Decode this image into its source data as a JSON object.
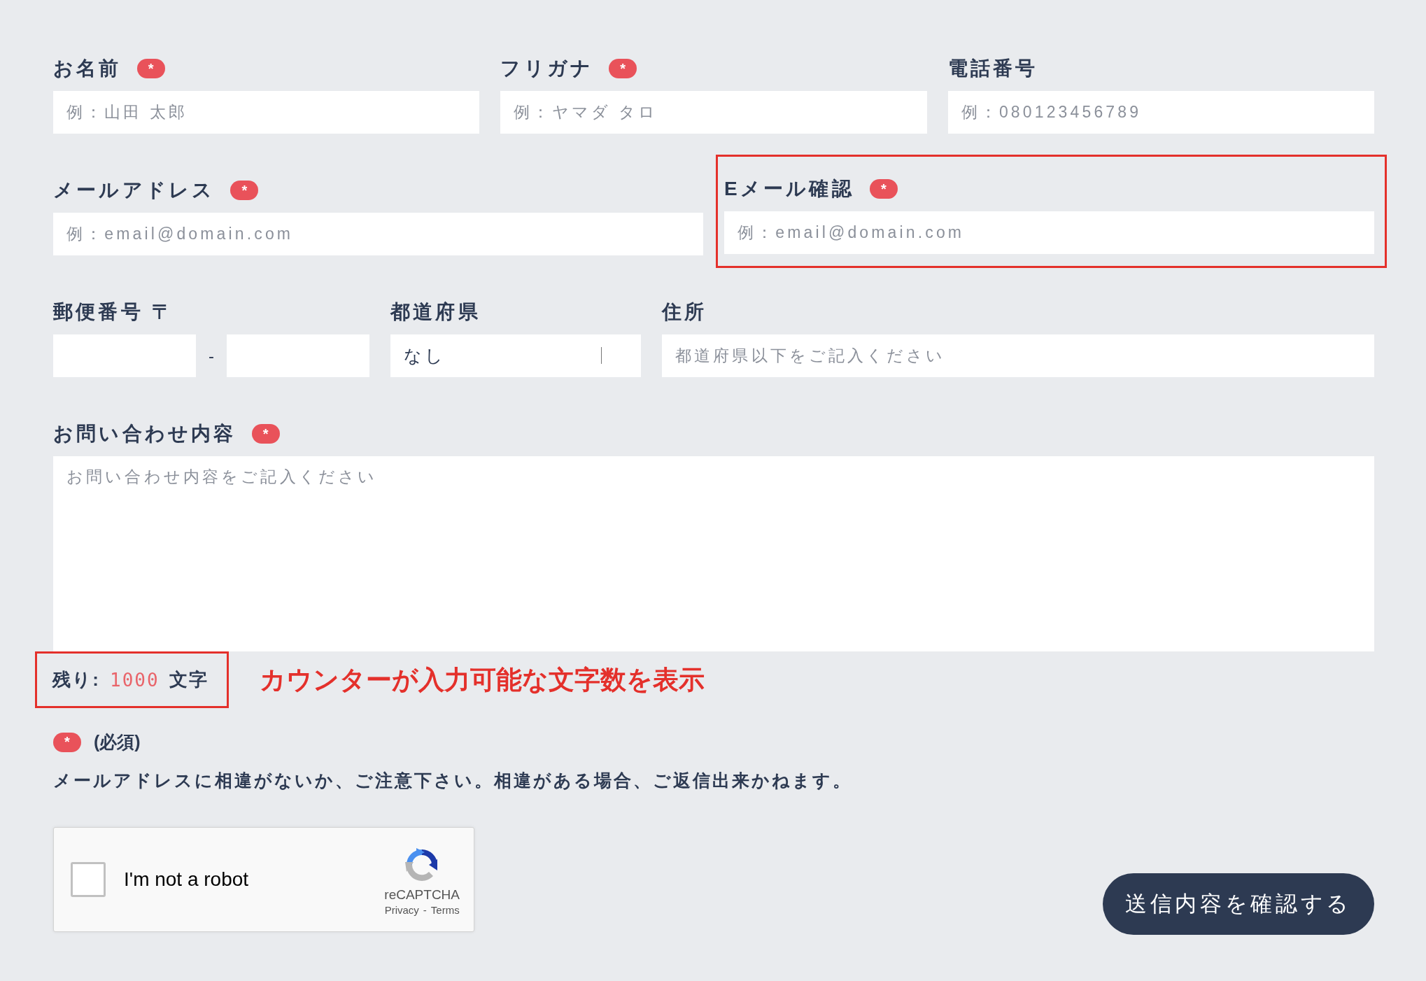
{
  "form_rows": [
    {
      "fields": [
        {
          "kind": "text",
          "label": "お名前",
          "badge": "*",
          "placeholder": "例：山田 太郎",
          "highlighted": false
        },
        {
          "kind": "text",
          "label": "フリガナ",
          "badge": "*",
          "placeholder": "例：ヤマダ タロ",
          "highlighted": false
        },
        {
          "kind": "text",
          "label": "電話番号",
          "placeholder": "例：080123456789",
          "highlighted": false
        }
      ]
    },
    {
      "fields": [
        {
          "kind": "text",
          "label": "メールアドレス",
          "badge": "*",
          "placeholder": "例：email@domain.com",
          "highlighted": false
        },
        {
          "kind": "text",
          "label": "Eメール確認",
          "badge": "*",
          "placeholder": "例：email@domain.com",
          "highlighted": true
        }
      ]
    },
    {
      "fields": [
        {
          "kind": "postal",
          "label": "郵便番号 〒",
          "separator": "-",
          "highlighted": false
        },
        {
          "kind": "select",
          "label": "都道府県",
          "value": "なし",
          "highlighted": false
        },
        {
          "kind": "text",
          "label": "住所",
          "placeholder": "都道府県以下をご記入ください",
          "highlighted": false
        }
      ]
    },
    {
      "fields": [
        {
          "kind": "textarea",
          "label": "お問い合わせ内容",
          "badge": "*",
          "placeholder": "お問い合わせ内容をご記入ください",
          "highlighted": false
        }
      ]
    }
  ],
  "counter": {
    "label": "残り:",
    "count": "1000",
    "unit": "文字",
    "highlighted": true
  },
  "annotation": "カウンターが入力可能な文字数を表示",
  "legend": {
    "badge": "*",
    "text": "(必須)"
  },
  "note": "メールアドレスに相違がないか、ご注意下さい。相違がある場合、ご返信出来かねます。",
  "captcha": {
    "label": "I'm not a robot",
    "checked": false,
    "brand": "reCAPTCHA",
    "links": [
      "Privacy",
      "-",
      "Terms"
    ]
  },
  "submit": "送信内容を確認する"
}
